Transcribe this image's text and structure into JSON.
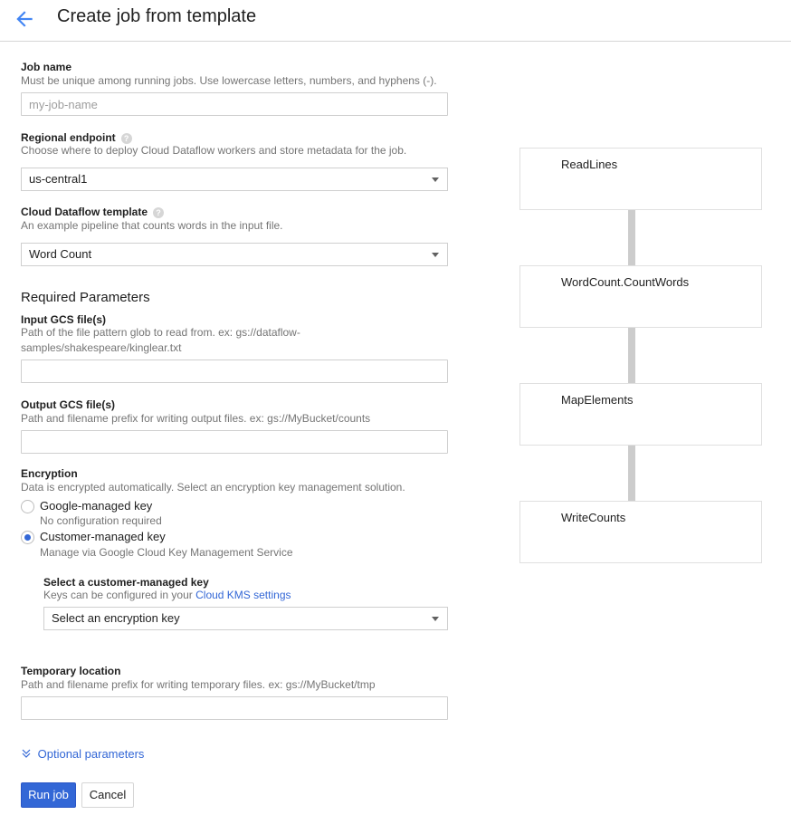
{
  "header": {
    "back_icon": "arrow-back-icon",
    "title": "Create job from template",
    "accent": "#4285f4"
  },
  "form": {
    "job_name": {
      "label": "Job name",
      "hint": "Must be unique among running jobs. Use lowercase letters, numbers, and hyphens (-).",
      "placeholder": "my-job-name",
      "value": ""
    },
    "regional_endpoint": {
      "label": "Regional endpoint",
      "help_icon": "help-icon",
      "hint": "Choose where to deploy Cloud Dataflow workers and store metadata for the job.",
      "selected": "us-central1"
    },
    "template": {
      "label": "Cloud Dataflow template",
      "help_icon": "help-icon",
      "hint": "An example pipeline that counts words in the input file.",
      "selected": "Word Count"
    },
    "required_title": "Required Parameters",
    "input_gcs": {
      "label": "Input GCS file(s)",
      "hint_line1": "Path of the file pattern glob to read from. ex: gs://dataflow-",
      "hint_line2": "samples/shakespeare/kinglear.txt",
      "value": ""
    },
    "output_gcs": {
      "label": "Output GCS file(s)",
      "hint": "Path and filename prefix for writing output files. ex: gs://MyBucket/counts",
      "value": ""
    },
    "encryption": {
      "label": "Encryption",
      "hint": "Data is encrypted automatically. Select an encryption key management solution.",
      "options": [
        {
          "label": "Google-managed key",
          "sub": "No configuration required",
          "selected": false
        },
        {
          "label": "Customer-managed key",
          "sub": "Manage via Google Cloud Key Management Service",
          "selected": true
        }
      ],
      "cmk": {
        "label": "Select a customer-managed key",
        "hint_prefix": "Keys can be configured in your",
        "link": "Cloud KMS settings",
        "selected": "Select an encryption key"
      }
    },
    "temp_location": {
      "label": "Temporary location",
      "hint": "Path and filename prefix for writing temporary files. ex: gs://MyBucket/tmp",
      "value": ""
    },
    "optional_params": {
      "icon": "double-chevron-down-icon",
      "label": "Optional parameters"
    }
  },
  "actions": {
    "run_label": "Run job",
    "cancel_label": "Cancel",
    "primary_color": "#3367d6"
  },
  "graph": {
    "nodes": [
      "ReadLines",
      "WordCount.CountWords",
      "MapElements",
      "WriteCounts"
    ]
  }
}
